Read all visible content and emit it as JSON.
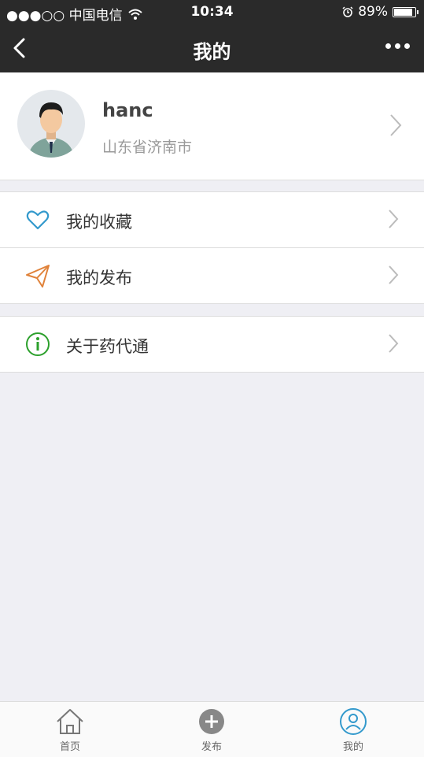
{
  "status": {
    "carrier": "●●●○○ 中国电信",
    "time": "10:34",
    "battery": "89%",
    "battery_level": 0.89
  },
  "nav": {
    "title": "我的",
    "back_icon": "chevron-left-icon",
    "more_icon": "more-dots-icon"
  },
  "profile": {
    "name": "hanc",
    "location": "山东省济南市"
  },
  "menu": {
    "favorites": "我的收藏",
    "published": "我的发布",
    "about": "关于药代通"
  },
  "tabs": {
    "home": "首页",
    "publish": "发布",
    "mine": "我的"
  },
  "colors": {
    "dark_bar": "#2a2a2a",
    "heart": "#3399cc",
    "send": "#e0823a",
    "info": "#2ca02c"
  }
}
